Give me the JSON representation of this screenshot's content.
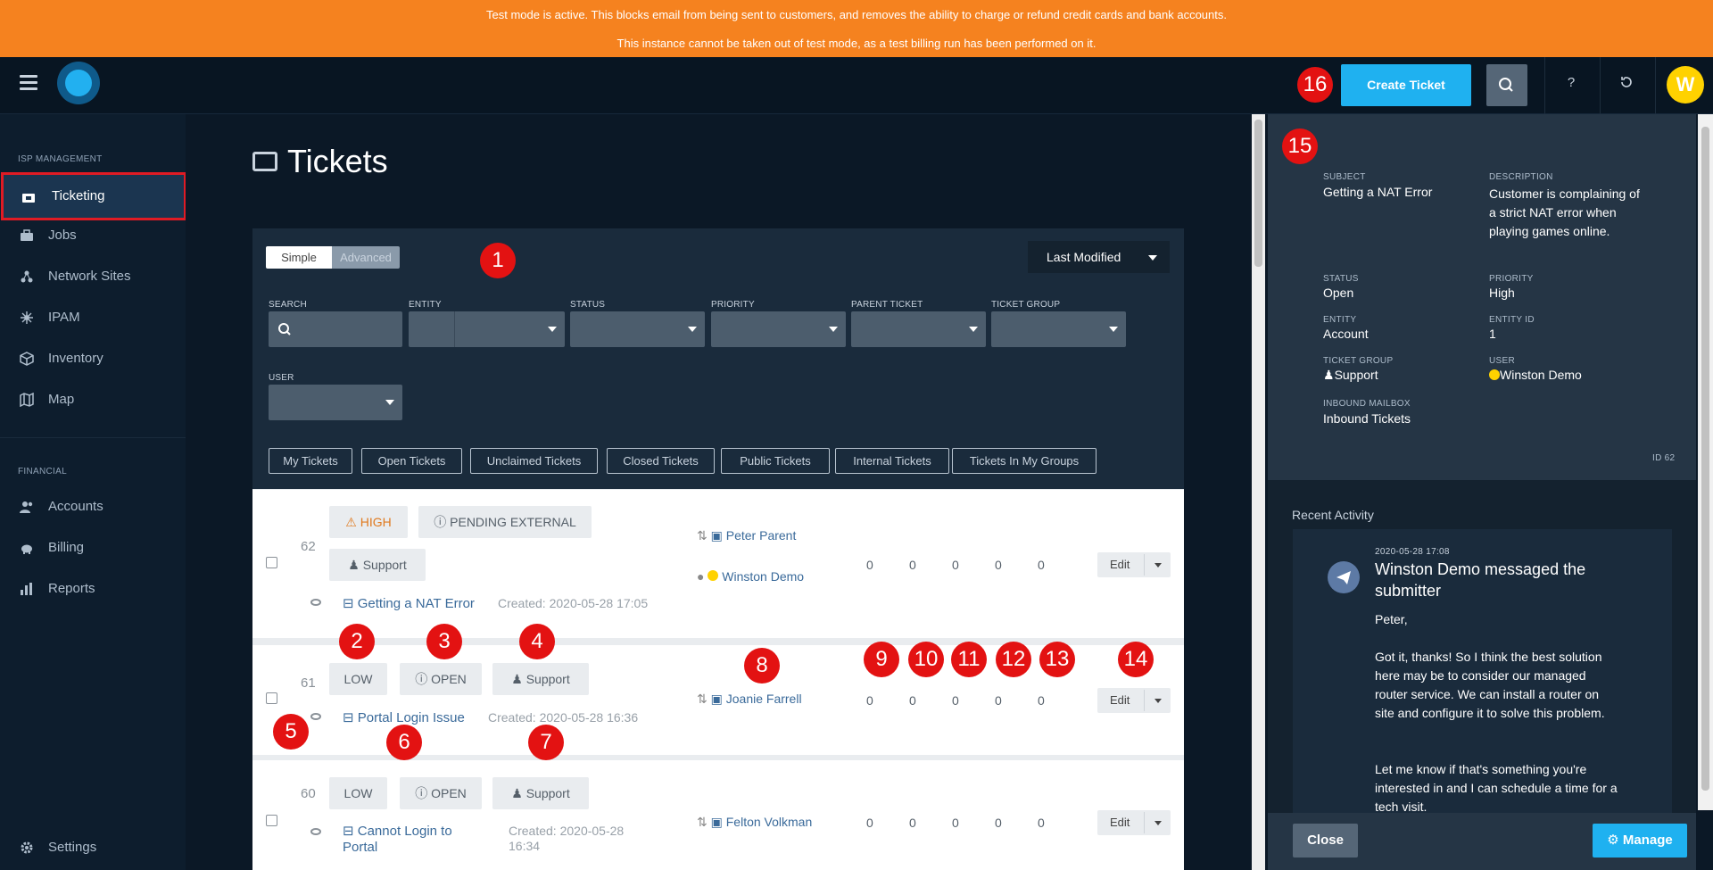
{
  "banner": {
    "line1": "Test mode is active. This blocks email from being sent to customers, and removes the ability to charge or refund credit cards and bank accounts.",
    "line2": "This instance cannot be taken out of test mode, as a test billing run has been performed on it."
  },
  "topbar": {
    "create_ticket": "Create Ticket",
    "help": "?",
    "avatar_initial": "W"
  },
  "sidebar": {
    "section_isp": "ISP MANAGEMENT",
    "section_financial": "FINANCIAL",
    "items": [
      {
        "label": "Ticketing",
        "icon": "ticket-icon"
      },
      {
        "label": "Jobs",
        "icon": "briefcase-icon"
      },
      {
        "label": "Network Sites",
        "icon": "network-icon"
      },
      {
        "label": "IPAM",
        "icon": "ipam-icon"
      },
      {
        "label": "Inventory",
        "icon": "box-icon"
      },
      {
        "label": "Map",
        "icon": "map-icon"
      },
      {
        "label": "Accounts",
        "icon": "users-icon"
      },
      {
        "label": "Billing",
        "icon": "piggy-bank-icon"
      },
      {
        "label": "Reports",
        "icon": "bar-chart-icon"
      },
      {
        "label": "Settings",
        "icon": "gear-icon"
      }
    ]
  },
  "page": {
    "title": "Tickets"
  },
  "filters": {
    "simple": "Simple",
    "advanced": "Advanced",
    "sort": "Last Modified",
    "labels": {
      "search": "SEARCH",
      "entity": "ENTITY",
      "status": "STATUS",
      "priority": "PRIORITY",
      "parent_ticket": "PARENT TICKET",
      "ticket_group": "TICKET GROUP",
      "user": "USER"
    },
    "quick": [
      "My Tickets",
      "Open Tickets",
      "Unclaimed Tickets",
      "Closed Tickets",
      "Public Tickets",
      "Internal Tickets",
      "Tickets In My Groups"
    ]
  },
  "tickets": [
    {
      "id": "62",
      "priority": "HIGH",
      "status": "PENDING EXTERNAL",
      "group": "Support",
      "subject": "Getting a NAT Error",
      "created": "Created: 2020-05-28 17:05",
      "assignee": "Peter Parent",
      "user": "Winston Demo",
      "counts": [
        "0",
        "0",
        "0",
        "0",
        "0"
      ],
      "edit": "Edit"
    },
    {
      "id": "61",
      "priority": "LOW",
      "status": "OPEN",
      "group": "Support",
      "subject": "Portal Login Issue",
      "created": "Created: 2020-05-28 16:36",
      "assignee": "Joanie Farrell",
      "counts": [
        "0",
        "0",
        "0",
        "0",
        "0"
      ],
      "edit": "Edit"
    },
    {
      "id": "60",
      "priority": "LOW",
      "status": "OPEN",
      "group": "Support",
      "subject": "Cannot Login to Portal",
      "created": "Created: 2020-05-28 16:34",
      "assignee": "Felton Volkman",
      "counts": [
        "0",
        "0",
        "0",
        "0",
        "0"
      ],
      "edit": "Edit"
    }
  ],
  "details": {
    "subject_label": "SUBJECT",
    "subject": "Getting a NAT Error",
    "description_label": "DESCRIPTION",
    "description": "Customer is complaining of a strict NAT error when playing games online.",
    "status_label": "STATUS",
    "status": "Open",
    "priority_label": "PRIORITY",
    "priority": "High",
    "entity_label": "ENTITY",
    "entity": "Account",
    "entity_id_label": "ENTITY ID",
    "entity_id": "1",
    "group_label": "TICKET GROUP",
    "group": "Support",
    "user_label": "USER",
    "user": "Winston Demo",
    "mailbox_label": "INBOUND MAILBOX",
    "mailbox": "Inbound Tickets",
    "id": "ID 62"
  },
  "activity": {
    "title": "Recent Activity",
    "date": "2020-05-28 17:08",
    "heading": "Winston Demo messaged the submitter",
    "greeting": "Peter,",
    "para1": "Got it, thanks! So I think the best solution here may be to consider our managed router service. We can install a router on site and configure it to solve this problem.",
    "para2": "Let me know if that's something you're interested in and I can schedule a time for a tech visit."
  },
  "footer": {
    "close": "Close",
    "manage": "Manage"
  },
  "callouts": [
    "1",
    "2",
    "3",
    "4",
    "5",
    "6",
    "7",
    "8",
    "9",
    "10",
    "11",
    "12",
    "13",
    "14",
    "15",
    "16"
  ],
  "colors": {
    "banner": "#f5821f",
    "accent": "#1fb1f0",
    "callout": "#e31212",
    "high": "#e07a1f"
  }
}
